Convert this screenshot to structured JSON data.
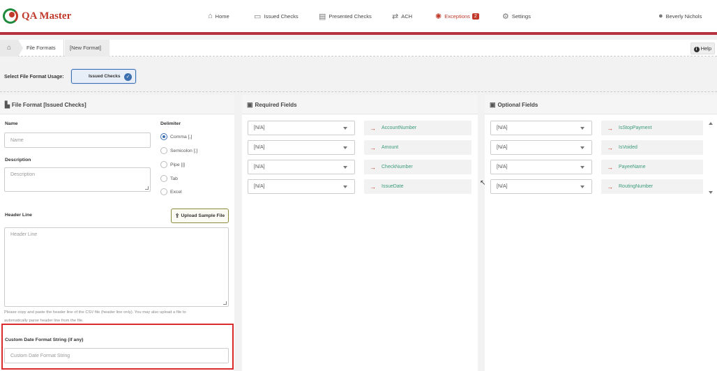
{
  "app": {
    "name": "QA Master"
  },
  "nav": {
    "home": "Home",
    "issued_checks": "Issued Checks",
    "presented_checks": "Presented Checks",
    "ach": "ACH",
    "exceptions": "Exceptions",
    "exceptions_count": "2",
    "settings": "Settings",
    "user": "Beverly Nichols"
  },
  "breadcrumb": {
    "items": [
      "File Formats",
      "[New Format]"
    ],
    "help": "Help"
  },
  "usage": {
    "label": "Select File Format Usage:",
    "selected": "Issued Checks"
  },
  "format_panel": {
    "title": "File Format [Issued Checks]",
    "name_label": "Name",
    "name_placeholder": "Name",
    "description_label": "Description",
    "description_placeholder": "Description",
    "delimiter_label": "Delimiter",
    "delimiters": [
      "Comma [,]",
      "Semicolon [;]",
      "Pipe [|]",
      "Tab",
      "Excel"
    ],
    "delimiter_selected": "Comma [,]",
    "header_line_label": "Header Line",
    "upload_button": "Upload Sample File",
    "header_line_placeholder": "Header Line",
    "hint_line1": "Please copy and paste the header line of the CSV file (header line only). You may also upload a file to",
    "hint_line2": "automatically parse header line from the file.",
    "custom_date_label": "Custom Date Format String (if any)",
    "custom_date_placeholder": "Custom Date Format String"
  },
  "required_panel": {
    "title": "Required Fields",
    "rows": [
      {
        "select": "[N/A]",
        "field": "AccountNumber"
      },
      {
        "select": "[N/A]",
        "field": "Amount"
      },
      {
        "select": "[N/A]",
        "field": "CheckNumber"
      },
      {
        "select": "[N/A]",
        "field": "IssueDate"
      }
    ]
  },
  "optional_panel": {
    "title": "Optional Fields",
    "rows": [
      {
        "select": "[N/A]",
        "field": "IsStopPayment"
      },
      {
        "select": "[N/A]",
        "field": "IsVoided"
      },
      {
        "select": "[N/A]",
        "field": "PayeeName"
      },
      {
        "select": "[N/A]",
        "field": "RoutingNumber"
      }
    ]
  },
  "colors": {
    "brand_red": "#b5323e",
    "accent_blue": "#3c6fb0",
    "field_green": "#3a9a7a",
    "highlight_red": "#d92b2b"
  }
}
